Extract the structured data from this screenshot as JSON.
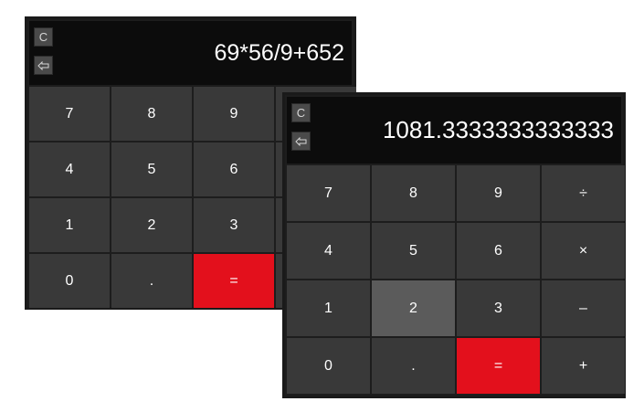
{
  "colors": {
    "background": "#ffffff",
    "body": "#1d1d1d",
    "display": "#0c0c0c",
    "key": "#393939",
    "key_pressed": "#5b5b5b",
    "equals": "#e3101c",
    "control": "#4a4a4a"
  },
  "calculator_back": {
    "controls": {
      "clear_label": "C",
      "backspace_icon": "backspace-arrow-icon"
    },
    "display_value": "69*56/9+652",
    "keys": [
      {
        "label": "7"
      },
      {
        "label": "8"
      },
      {
        "label": "9"
      },
      {
        "label": "÷"
      },
      {
        "label": "4"
      },
      {
        "label": "5"
      },
      {
        "label": "6"
      },
      {
        "label": "×"
      },
      {
        "label": "1"
      },
      {
        "label": "2"
      },
      {
        "label": "3"
      },
      {
        "label": "–"
      },
      {
        "label": "0"
      },
      {
        "label": "."
      },
      {
        "label": "="
      },
      {
        "label": "+"
      }
    ]
  },
  "calculator_front": {
    "controls": {
      "clear_label": "C",
      "backspace_icon": "backspace-arrow-icon"
    },
    "display_value": "1081.3333333333333",
    "pressed_key": "2",
    "keys": [
      {
        "label": "7"
      },
      {
        "label": "8"
      },
      {
        "label": "9"
      },
      {
        "label": "÷"
      },
      {
        "label": "4"
      },
      {
        "label": "5"
      },
      {
        "label": "6"
      },
      {
        "label": "×"
      },
      {
        "label": "1"
      },
      {
        "label": "2"
      },
      {
        "label": "3"
      },
      {
        "label": "–"
      },
      {
        "label": "0"
      },
      {
        "label": "."
      },
      {
        "label": "="
      },
      {
        "label": "+"
      }
    ]
  }
}
